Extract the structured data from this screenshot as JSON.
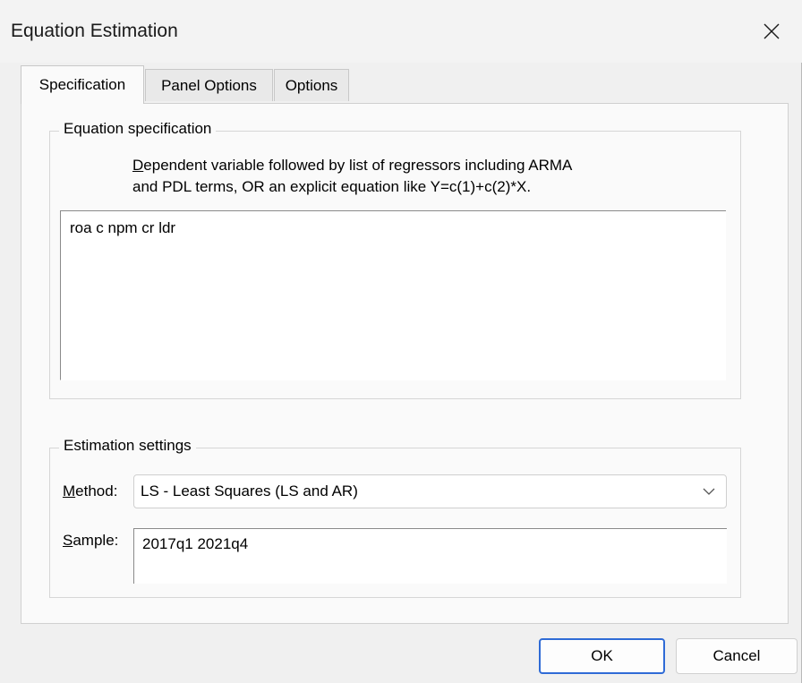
{
  "window": {
    "title": "Equation Estimation",
    "close_icon": "close-icon"
  },
  "tabs": [
    {
      "label": "Specification",
      "active": true
    },
    {
      "label": "Panel Options",
      "active": false
    },
    {
      "label": "Options",
      "active": false
    }
  ],
  "equation_spec": {
    "group_title": "Equation specification",
    "instruction_first_letter": "D",
    "instruction_line1_rest": "ependent variable followed by list of regressors including ARMA",
    "instruction_line2": "and PDL terms, OR an explicit equation like Y=c(1)+c(2)*X.",
    "equation_value": "roa c npm cr ldr"
  },
  "estimation_settings": {
    "group_title": "Estimation settings",
    "method_label_accel": "M",
    "method_label_rest": "ethod:",
    "method_value": "LS  -  Least Squares (LS and AR)",
    "sample_label_accel": "S",
    "sample_label_rest": "ample:",
    "sample_value": "2017q1 2021q4"
  },
  "buttons": {
    "ok": "OK",
    "cancel": "Cancel"
  },
  "colors": {
    "dialog_bg": "#f0f0f0",
    "panel_bg": "#fafafa",
    "accent_default_button": "#2f6bd6"
  }
}
